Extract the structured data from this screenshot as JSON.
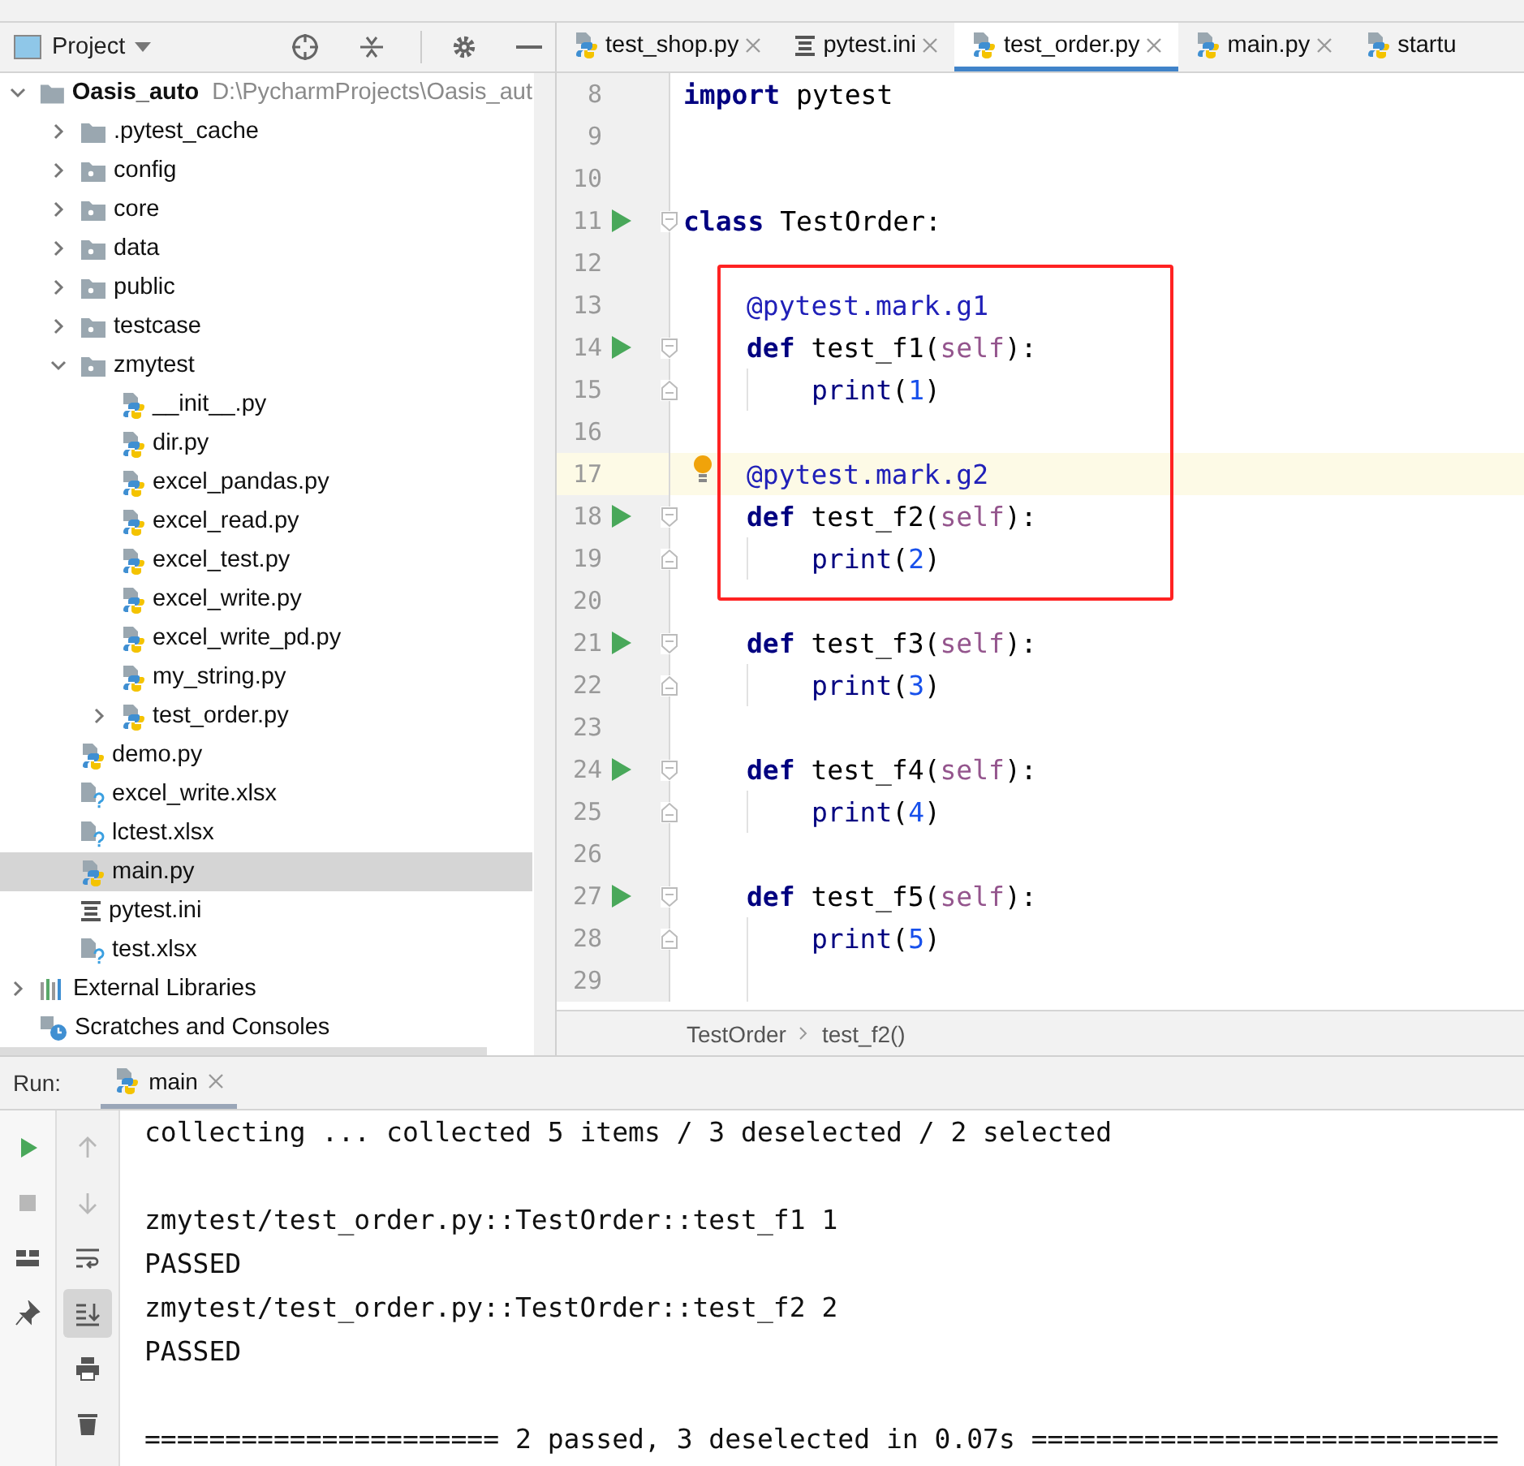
{
  "project_panel": {
    "title": "Project",
    "tree": [
      {
        "label": "Oasis_auto",
        "kind": "folder",
        "hint": "D:\\PycharmProjects\\Oasis_aut",
        "expanded": true,
        "selected": false,
        "children": [
          {
            "label": ".pytest_cache",
            "kind": "folder",
            "expanded": false,
            "selected": false
          },
          {
            "label": "config",
            "kind": "package",
            "expanded": false,
            "selected": false
          },
          {
            "label": "core",
            "kind": "package",
            "expanded": false,
            "selected": false
          },
          {
            "label": "data",
            "kind": "package",
            "expanded": false,
            "selected": false
          },
          {
            "label": "public",
            "kind": "package",
            "expanded": false,
            "selected": false
          },
          {
            "label": "testcase",
            "kind": "package",
            "expanded": false,
            "selected": false
          },
          {
            "label": "zmytest",
            "kind": "package",
            "expanded": true,
            "selected": false,
            "children": [
              {
                "label": "__init__.py",
                "kind": "python",
                "selected": false
              },
              {
                "label": "dir.py",
                "kind": "python",
                "selected": false
              },
              {
                "label": "excel_pandas.py",
                "kind": "python",
                "selected": false
              },
              {
                "label": "excel_read.py",
                "kind": "python",
                "selected": false
              },
              {
                "label": "excel_test.py",
                "kind": "python",
                "selected": false
              },
              {
                "label": "excel_write.py",
                "kind": "python",
                "selected": false
              },
              {
                "label": "excel_write_pd.py",
                "kind": "python",
                "selected": false
              },
              {
                "label": "my_string.py",
                "kind": "python",
                "selected": false
              },
              {
                "label": "test_order.py",
                "kind": "python",
                "expanded": false,
                "selected": false
              }
            ]
          },
          {
            "label": "demo.py",
            "kind": "python",
            "selected": false
          },
          {
            "label": "excel_write.xlsx",
            "kind": "unknown",
            "selected": false
          },
          {
            "label": "lctest.xlsx",
            "kind": "unknown",
            "selected": false
          },
          {
            "label": "main.py",
            "kind": "python",
            "selected": true
          },
          {
            "label": "pytest.ini",
            "kind": "ini",
            "selected": false
          },
          {
            "label": "test.xlsx",
            "kind": "unknown",
            "selected": false
          }
        ]
      },
      {
        "label": "External Libraries",
        "kind": "library",
        "expanded": false,
        "selected": false
      },
      {
        "label": "Scratches and Consoles",
        "kind": "scratches",
        "selected": false
      }
    ]
  },
  "editor": {
    "tabs": [
      {
        "label": "test_shop.py",
        "kind": "python",
        "selected": false,
        "closable": true
      },
      {
        "label": "pytest.ini",
        "kind": "ini",
        "selected": false,
        "closable": true
      },
      {
        "label": "test_order.py",
        "kind": "python",
        "selected": true,
        "closable": true
      },
      {
        "label": "main.py",
        "kind": "python",
        "selected": false,
        "closable": true
      },
      {
        "label": "startu",
        "kind": "python",
        "selected": false,
        "closable": false
      }
    ],
    "lines": [
      {
        "number": "8",
        "kind": "top",
        "tokens": [
          {
            "kind": "keyword",
            "text": "import"
          },
          {
            "kind": "plain",
            "text": " pytest"
          }
        ]
      },
      {
        "number": "9",
        "kind": "blank"
      },
      {
        "number": "10",
        "kind": "blank"
      },
      {
        "number": "11",
        "kind": "top",
        "run": true,
        "fold_start": true,
        "tokens": [
          {
            "kind": "keyword",
            "text": "class"
          },
          {
            "kind": "plain",
            "text": " TestOrder:"
          }
        ]
      },
      {
        "number": "12",
        "kind": "blank"
      },
      {
        "kind": "boxed",
        "lines": [
          {
            "number": "13",
            "kind": "member",
            "tokens": [
              {
                "kind": "decorator",
                "text": "@pytest.mark.g1"
              }
            ]
          },
          {
            "number": "14",
            "kind": "member",
            "run": true,
            "fold_start": true,
            "tokens": [
              {
                "kind": "keyword",
                "text": "def"
              },
              {
                "kind": "plain",
                "text": " test_f1("
              },
              {
                "kind": "self",
                "text": "self"
              },
              {
                "kind": "plain",
                "text": "):"
              }
            ]
          },
          {
            "number": "15",
            "kind": "body",
            "fold_end": true,
            "tokens": [
              {
                "kind": "builtin",
                "text": "print"
              },
              {
                "kind": "plain",
                "text": "("
              },
              {
                "kind": "number",
                "text": "1"
              },
              {
                "kind": "plain",
                "text": ")"
              }
            ]
          },
          {
            "number": "16",
            "kind": "blank"
          },
          {
            "number": "17",
            "kind": "member",
            "current": true,
            "bulb": true,
            "tokens": [
              {
                "kind": "decorator",
                "text": "@pytest.mark.g2"
              }
            ]
          },
          {
            "number": "18",
            "kind": "member",
            "run": true,
            "fold_start": true,
            "tokens": [
              {
                "kind": "keyword",
                "text": "def"
              },
              {
                "kind": "plain",
                "text": " test_f2("
              },
              {
                "kind": "self",
                "text": "self"
              },
              {
                "kind": "plain",
                "text": "):"
              }
            ]
          },
          {
            "number": "19",
            "kind": "body",
            "fold_end": true,
            "tokens": [
              {
                "kind": "builtin",
                "text": "print"
              },
              {
                "kind": "plain",
                "text": "("
              },
              {
                "kind": "number",
                "text": "2"
              },
              {
                "kind": "plain",
                "text": ")"
              }
            ]
          }
        ]
      },
      {
        "number": "20",
        "kind": "blank"
      },
      {
        "number": "21",
        "kind": "member",
        "run": true,
        "fold_start": true,
        "tokens": [
          {
            "kind": "keyword",
            "text": "def"
          },
          {
            "kind": "plain",
            "text": " test_f3("
          },
          {
            "kind": "self",
            "text": "self"
          },
          {
            "kind": "plain",
            "text": "):"
          }
        ]
      },
      {
        "number": "22",
        "kind": "body",
        "fold_end": true,
        "tokens": [
          {
            "kind": "builtin",
            "text": "print"
          },
          {
            "kind": "plain",
            "text": "("
          },
          {
            "kind": "number",
            "text": "3"
          },
          {
            "kind": "plain",
            "text": ")"
          }
        ]
      },
      {
        "number": "23",
        "kind": "blank"
      },
      {
        "number": "24",
        "kind": "member",
        "run": true,
        "fold_start": true,
        "tokens": [
          {
            "kind": "keyword",
            "text": "def"
          },
          {
            "kind": "plain",
            "text": " test_f4("
          },
          {
            "kind": "self",
            "text": "self"
          },
          {
            "kind": "plain",
            "text": "):"
          }
        ]
      },
      {
        "number": "25",
        "kind": "body",
        "fold_end": true,
        "tokens": [
          {
            "kind": "builtin",
            "text": "print"
          },
          {
            "kind": "plain",
            "text": "("
          },
          {
            "kind": "number",
            "text": "4"
          },
          {
            "kind": "plain",
            "text": ")"
          }
        ]
      },
      {
        "number": "26",
        "kind": "blank"
      },
      {
        "number": "27",
        "kind": "member",
        "run": true,
        "fold_start": true,
        "tokens": [
          {
            "kind": "keyword",
            "text": "def"
          },
          {
            "kind": "plain",
            "text": " test_f5("
          },
          {
            "kind": "self",
            "text": "self"
          },
          {
            "kind": "plain",
            "text": "):"
          }
        ]
      },
      {
        "number": "28",
        "kind": "body",
        "fold_end": true,
        "tokens": [
          {
            "kind": "builtin",
            "text": "print"
          },
          {
            "kind": "plain",
            "text": "("
          },
          {
            "kind": "number",
            "text": "5"
          },
          {
            "kind": "plain",
            "text": ")"
          }
        ]
      },
      {
        "number": "29",
        "kind": "blank",
        "guide": true
      }
    ],
    "breadcrumb": [
      "TestOrder",
      "test_f2()"
    ]
  },
  "run_panel": {
    "label": "Run:",
    "tab": {
      "label": "main",
      "selected": true
    },
    "toolbar": [
      {
        "kind": "rerun",
        "disabled": false,
        "selected": false
      },
      {
        "kind": "stop",
        "disabled": true,
        "selected": false
      },
      {
        "kind": "layout",
        "disabled": false,
        "selected": false
      },
      {
        "kind": "pin",
        "disabled": false,
        "selected": false
      }
    ],
    "toolbar2": [
      {
        "kind": "up",
        "disabled": true,
        "selected": false
      },
      {
        "kind": "down",
        "disabled": true,
        "selected": false
      },
      {
        "kind": "wrap",
        "disabled": false,
        "selected": false
      },
      {
        "kind": "scroll-end",
        "disabled": false,
        "selected": true
      },
      {
        "kind": "print",
        "disabled": false,
        "selected": false
      },
      {
        "kind": "trash",
        "disabled": false,
        "selected": false
      }
    ],
    "console": [
      [
        "collecting ... collected 5 items / 3 deselected / 2 selected"
      ],
      [
        "zmytest/test_order.py::TestOrder::test_f1 1",
        "PASSED",
        "zmytest/test_order.py::TestOrder::test_f2 2",
        "PASSED"
      ],
      [
        "====================== 2 passed, 3 deselected in 0.07s ============================="
      ]
    ]
  }
}
